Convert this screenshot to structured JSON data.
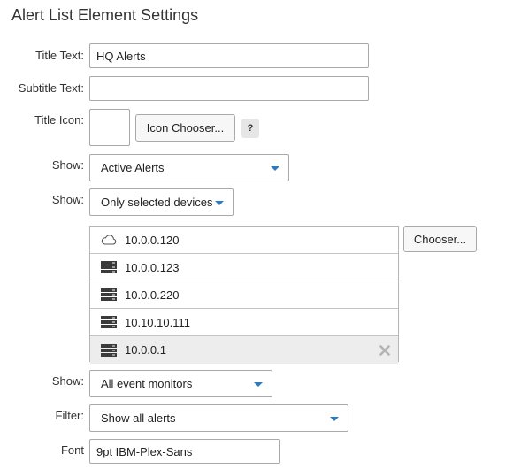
{
  "page": {
    "title": "Alert List Element Settings"
  },
  "form": {
    "title_text": {
      "label": "Title Text:",
      "value": "HQ Alerts"
    },
    "subtitle_text": {
      "label": "Subtitle Text:",
      "value": ""
    },
    "title_icon": {
      "label": "Title Icon:",
      "chooser_label": "Icon Chooser...",
      "help_label": "?"
    },
    "show_alerts": {
      "label": "Show:",
      "selected": "Active Alerts"
    },
    "show_devices": {
      "label": "Show:",
      "selected": "Only selected devices"
    },
    "devices": {
      "chooser_label": "Chooser...",
      "items": [
        {
          "name": "10.0.0.120",
          "icon": "cloud-icon"
        },
        {
          "name": "10.0.0.123",
          "icon": "server-icon"
        },
        {
          "name": "10.0.0.220",
          "icon": "server-icon"
        },
        {
          "name": "10.10.10.111",
          "icon": "server-icon"
        },
        {
          "name": "10.0.0.1",
          "icon": "server-icon",
          "selected": true
        }
      ]
    },
    "show_monitors": {
      "label": "Show:",
      "selected": "All event monitors"
    },
    "filter": {
      "label": "Filter:",
      "selected": "Show all alerts"
    },
    "font": {
      "label": "Font",
      "value": "9pt IBM-Plex-Sans"
    }
  },
  "colors": {
    "caret": "#2a7bbf",
    "selected_row": "#ededed"
  }
}
